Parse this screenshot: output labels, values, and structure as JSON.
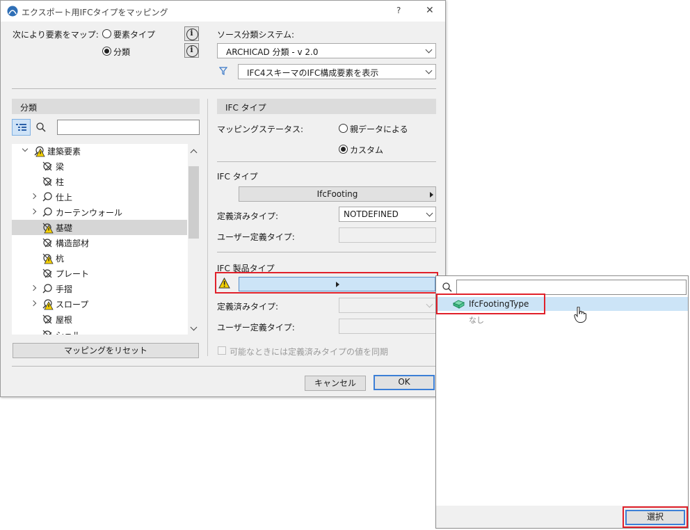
{
  "window": {
    "title": "エクスポート用IFCタイプをマッピング",
    "help_glyph": "?",
    "close_glyph": "✕"
  },
  "map_by": {
    "label": "次により要素をマップ:",
    "options": [
      "要素タイプ",
      "分類"
    ],
    "selected": "分類",
    "info_glyph": "i"
  },
  "source_system": {
    "label": "ソース分類システム:",
    "value": "ARCHICAD 分類 - v 2.0",
    "filter_value": "IFC4スキーマのIFC構成要素を表示"
  },
  "classification_panel": {
    "header": "分類",
    "search_value": "",
    "tree": [
      {
        "label": "建築要素",
        "level": 0,
        "expander": "open",
        "icon": "warning-classification-icon"
      },
      {
        "label": "梁",
        "level": 1,
        "expander": "none",
        "icon": "unmapped-classification-icon"
      },
      {
        "label": "柱",
        "level": 1,
        "expander": "none",
        "icon": "unmapped-classification-icon"
      },
      {
        "label": "仕上",
        "level": 1,
        "expander": "closed",
        "icon": "mapped-classification-icon"
      },
      {
        "label": "カーテンウォール",
        "level": 1,
        "expander": "closed",
        "icon": "mapped-classification-icon"
      },
      {
        "label": "基礎",
        "level": 1,
        "expander": "none",
        "icon": "warning-unmapped-icon",
        "selected": true
      },
      {
        "label": "構造部材",
        "level": 1,
        "expander": "none",
        "icon": "unmapped-classification-icon"
      },
      {
        "label": "杭",
        "level": 1,
        "expander": "none",
        "icon": "warning-unmapped-icon"
      },
      {
        "label": "プレート",
        "level": 1,
        "expander": "none",
        "icon": "unmapped-classification-icon"
      },
      {
        "label": "手摺",
        "level": 1,
        "expander": "closed",
        "icon": "mapped-classification-icon"
      },
      {
        "label": "スロープ",
        "level": 1,
        "expander": "closed",
        "icon": "warning-classification-icon"
      },
      {
        "label": "屋根",
        "level": 1,
        "expander": "none",
        "icon": "unmapped-classification-icon"
      },
      {
        "label": "シェル",
        "level": 1,
        "expander": "none",
        "icon": "unmapped-classification-icon"
      }
    ],
    "reset_button": "マッピングをリセット"
  },
  "ifc_panel": {
    "header": "IFC タイプ",
    "status_label": "マッピングステータス:",
    "status_options": [
      "親データによる",
      "カスタム"
    ],
    "status_selected": "カスタム",
    "ifc_type_label": "IFC タイプ",
    "ifc_type_value": "IfcFooting",
    "predefined_label": "定義済みタイプ:",
    "predefined_value": "NOTDEFINED",
    "userdef_label": "ユーザー定義タイプ:",
    "userdef_value": "",
    "product_type_label": "IFC 製品タイプ",
    "product_type_value": "",
    "product_predefined_label": "定義済みタイプ:",
    "product_userdef_label": "ユーザー定義タイプ:",
    "sync_label": "可能なときには定義済みタイプの値を同期"
  },
  "footer": {
    "cancel": "キャンセル",
    "ok": "OK"
  },
  "popup": {
    "search_value": "",
    "items": [
      {
        "label": "IfcFootingType",
        "icon": "ifc-type-icon",
        "highlighted": true
      },
      {
        "label": "なし",
        "icon": "",
        "highlighted": false
      }
    ],
    "select_button": "選択"
  },
  "colors": {
    "highlight": "#cce4f7",
    "accent_blue": "#3c7fd6",
    "callout_red": "#e0202a",
    "warning_yellow": "#f5d000"
  }
}
